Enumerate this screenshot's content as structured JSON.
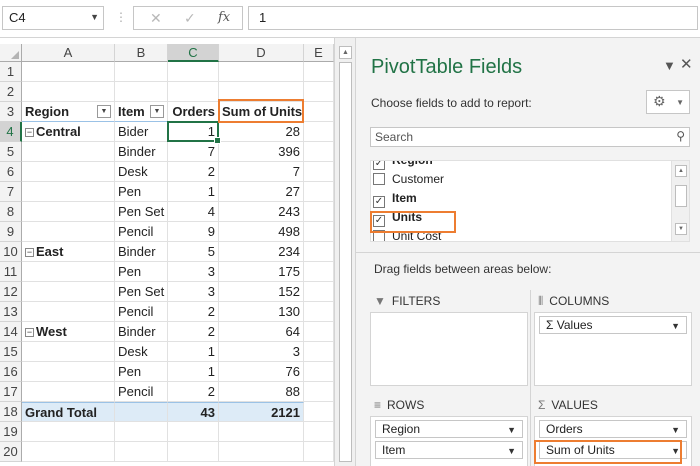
{
  "formula_bar": {
    "name_box": "C4",
    "cancel_icon": "✕",
    "enter_icon": "✓",
    "fx_icon": "fx",
    "value": "1"
  },
  "grid": {
    "columns": [
      "A",
      "B",
      "C",
      "D",
      "E"
    ],
    "rows": [
      "1",
      "2",
      "3",
      "4",
      "5",
      "6",
      "7",
      "8",
      "9",
      "10",
      "11",
      "12",
      "13",
      "14",
      "15",
      "16",
      "17",
      "18",
      "19",
      "20"
    ],
    "header": {
      "region": "Region",
      "item": "Item",
      "orders": "Orders",
      "units": "Sum of Units"
    },
    "data_rows": [
      {
        "row": 4,
        "region": "Central",
        "item": "Bider",
        "orders": "1",
        "units": "28"
      },
      {
        "row": 5,
        "region": "",
        "item": "Binder",
        "orders": "7",
        "units": "396"
      },
      {
        "row": 6,
        "region": "",
        "item": "Desk",
        "orders": "2",
        "units": "7"
      },
      {
        "row": 7,
        "region": "",
        "item": "Pen",
        "orders": "1",
        "units": "27"
      },
      {
        "row": 8,
        "region": "",
        "item": "Pen Set",
        "orders": "4",
        "units": "243"
      },
      {
        "row": 9,
        "region": "",
        "item": "Pencil",
        "orders": "9",
        "units": "498"
      },
      {
        "row": 10,
        "region": "East",
        "item": "Binder",
        "orders": "5",
        "units": "234"
      },
      {
        "row": 11,
        "region": "",
        "item": "Pen",
        "orders": "3",
        "units": "175"
      },
      {
        "row": 12,
        "region": "",
        "item": "Pen Set",
        "orders": "3",
        "units": "152"
      },
      {
        "row": 13,
        "region": "",
        "item": "Pencil",
        "orders": "2",
        "units": "130"
      },
      {
        "row": 14,
        "region": "West",
        "item": "Binder",
        "orders": "2",
        "units": "64"
      },
      {
        "row": 15,
        "region": "",
        "item": "Desk",
        "orders": "1",
        "units": "3"
      },
      {
        "row": 16,
        "region": "",
        "item": "Pen",
        "orders": "1",
        "units": "76"
      },
      {
        "row": 17,
        "region": "",
        "item": "Pencil",
        "orders": "2",
        "units": "88"
      }
    ],
    "grand_total": {
      "label": "Grand Total",
      "orders": "43",
      "units": "2121"
    }
  },
  "pivot_pane": {
    "title": "PivotTable Fields",
    "choose_label": "Choose fields to add to report:",
    "search_placeholder": "Search",
    "fields": [
      {
        "label": "Region",
        "checked": true,
        "bold": true
      },
      {
        "label": "Customer",
        "checked": false,
        "bold": false
      },
      {
        "label": "Item",
        "checked": true,
        "bold": true
      },
      {
        "label": "Units",
        "checked": true,
        "bold": true
      },
      {
        "label": "Unit Cost",
        "checked": false,
        "bold": false
      }
    ],
    "drag_label": "Drag fields between areas below:",
    "areas": {
      "filters": {
        "label": "FILTERS",
        "items": []
      },
      "columns": {
        "label": "COLUMNS",
        "items": [
          "Σ Values"
        ]
      },
      "rows": {
        "label": "ROWS",
        "items": [
          "Region",
          "Item"
        ]
      },
      "values": {
        "label": "VALUES",
        "items": [
          "Orders",
          "Sum of Units"
        ]
      }
    }
  },
  "colors": {
    "accent_green": "#217346",
    "highlight_orange": "#ed7d31",
    "total_row_fill": "#ddebf7"
  }
}
